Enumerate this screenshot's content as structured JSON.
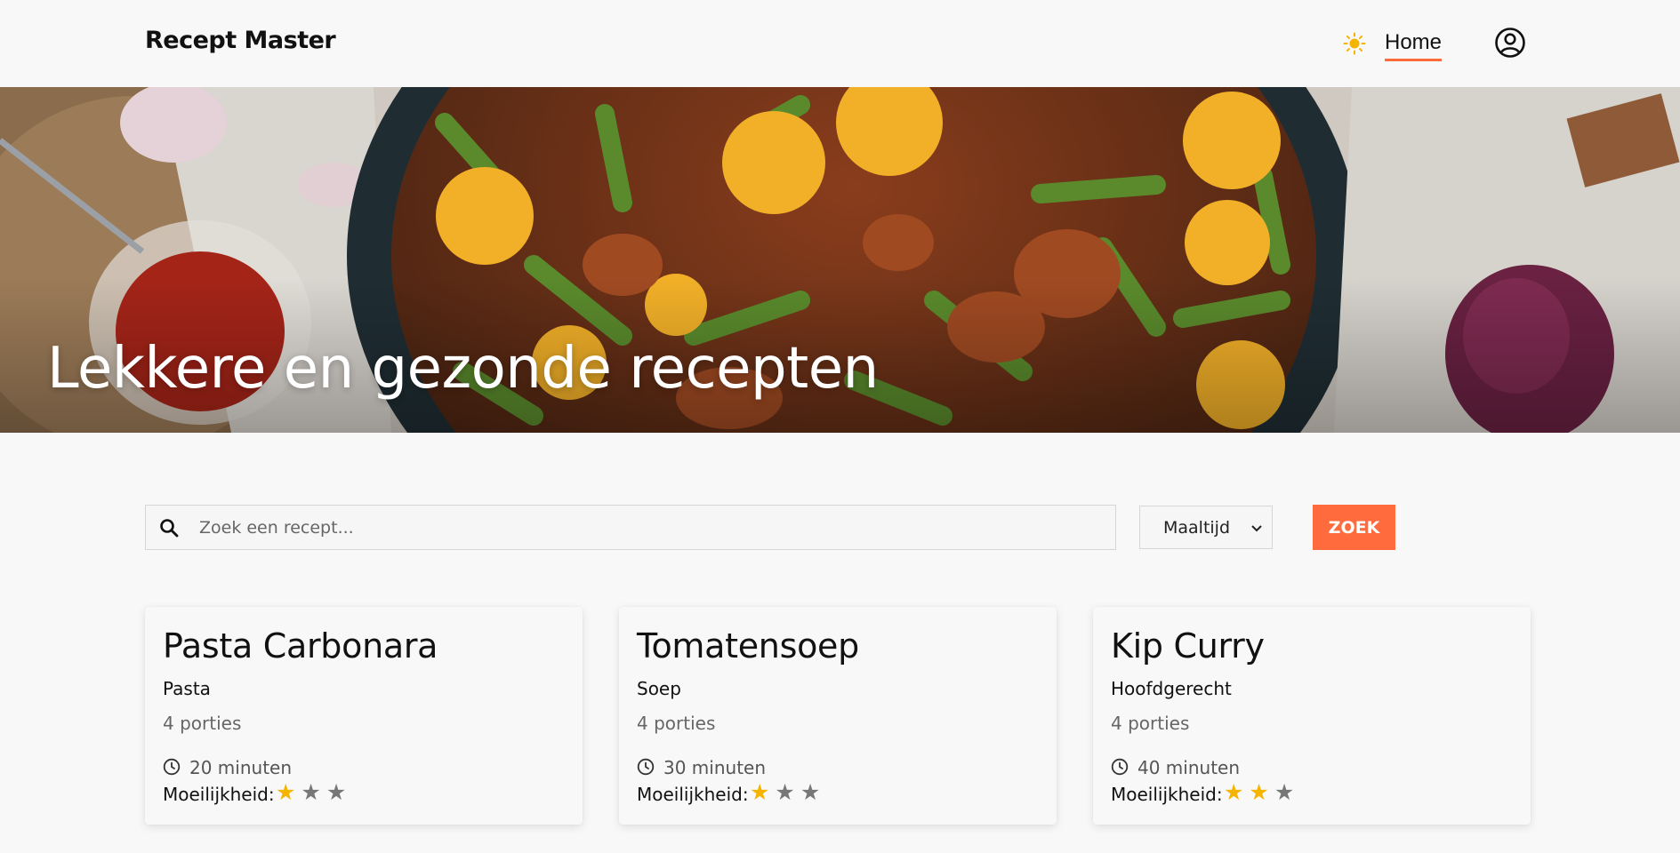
{
  "header": {
    "logo": "Recept Master",
    "nav_home": "Home",
    "theme_icon": "sun-icon",
    "profile_icon": "user-circle-icon"
  },
  "hero": {
    "title": "Lekkere en gezonde recepten"
  },
  "search": {
    "placeholder": "Zoek een recept...",
    "value": "",
    "filter_selected": "Maaltijd",
    "button_label": "ZOEK"
  },
  "recipes": [
    {
      "title": "Pasta Carbonara",
      "category": "Pasta",
      "portions": "4 porties",
      "time": "20 minuten",
      "difficulty_label": "Moeilijkheid:",
      "difficulty": 1,
      "difficulty_max": 3
    },
    {
      "title": "Tomatensoep",
      "category": "Soep",
      "portions": "4 porties",
      "time": "30 minuten",
      "difficulty_label": "Moeilijkheid:",
      "difficulty": 1,
      "difficulty_max": 3
    },
    {
      "title": "Kip Curry",
      "category": "Hoofdgerecht",
      "portions": "4 porties",
      "time": "40 minuten",
      "difficulty_label": "Moeilijkheid:",
      "difficulty": 2,
      "difficulty_max": 3
    }
  ],
  "colors": {
    "accent": "#ff6b3d",
    "star_active": "#f5b400",
    "star_inactive": "#777777",
    "background": "#f8f8f8"
  }
}
